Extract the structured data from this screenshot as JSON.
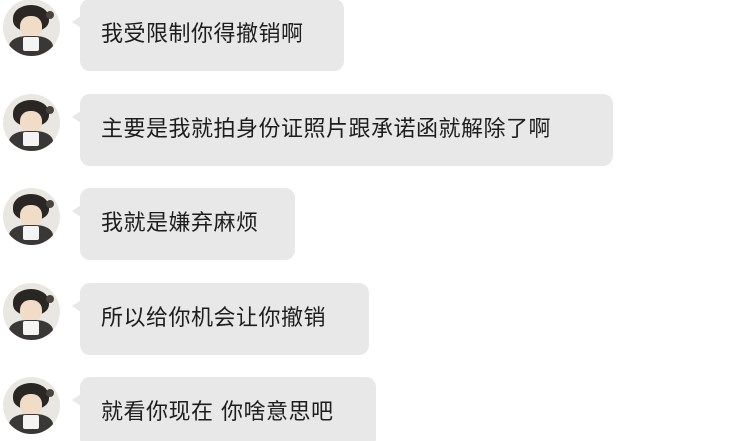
{
  "messages": [
    {
      "text": "我受限制你得撤销啊"
    },
    {
      "text": "主要是我就拍身份证照片跟承诺函就解除了啊"
    },
    {
      "text": "我就是嫌弃麻烦"
    },
    {
      "text": "所以给你机会让你撤销"
    },
    {
      "text": "就看你现在 你啥意思吧"
    }
  ]
}
